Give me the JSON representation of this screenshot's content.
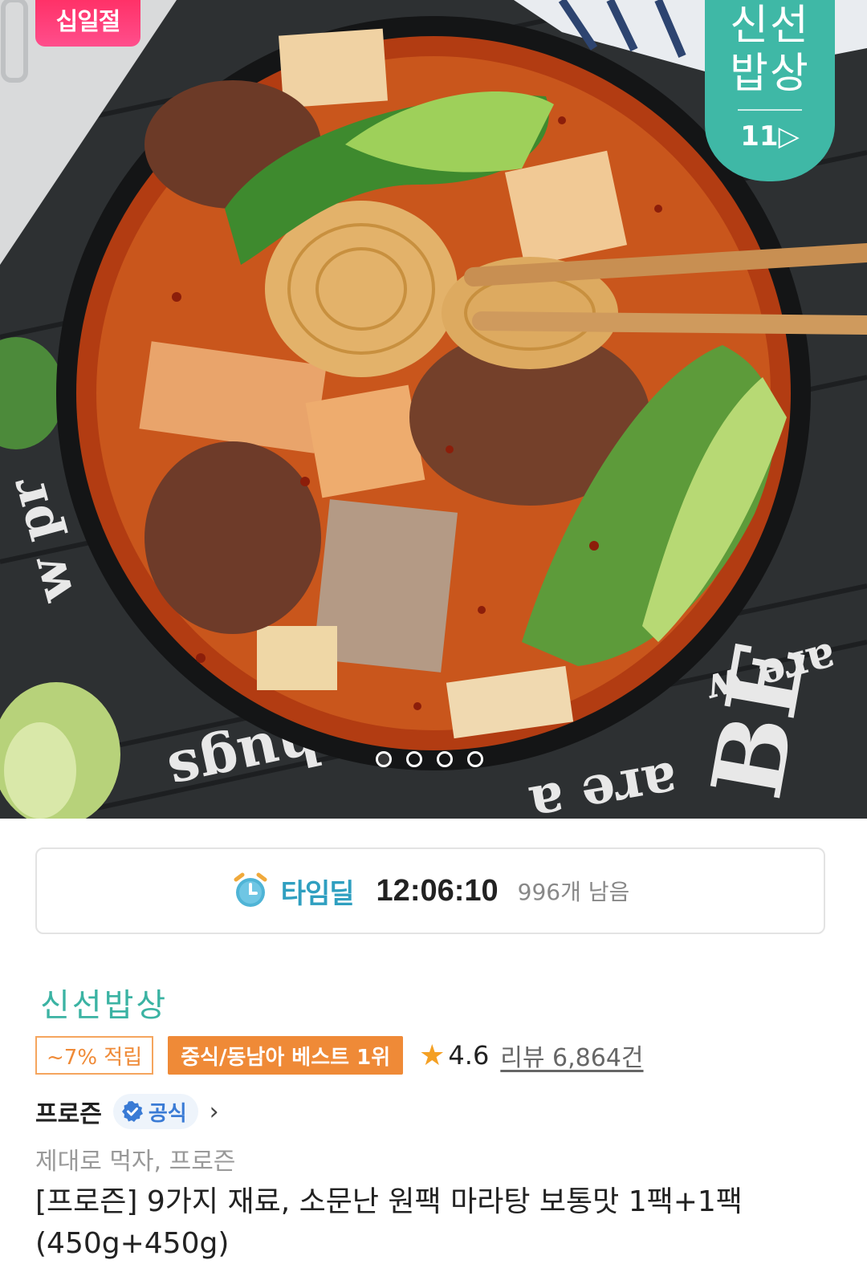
{
  "hero": {
    "event_tag": "십일절",
    "brand_badge": {
      "line1": "신선",
      "line2": "밥상",
      "number": "11▷"
    },
    "carousel": {
      "total": 4,
      "active": 0
    },
    "background_text": [
      "BE",
      "hugs",
      "are a",
      "are w",
      "w pr"
    ]
  },
  "timedeal": {
    "icon": "alarm-clock-icon",
    "label": "타임딜",
    "countdown": "12:06:10",
    "remaining": "996개 남음"
  },
  "store": {
    "name": "신선밥상"
  },
  "tags": {
    "point": "~7% 적립",
    "best": "중식/동남아 베스트 1위",
    "rating": "4.6",
    "reviews": "리뷰 6,864건"
  },
  "seller": {
    "name": "프로즌",
    "official_label": "공식",
    "chevron": "›"
  },
  "product": {
    "subtitle": "제대로 먹자, 프로즌",
    "title": "[프로즌] 9가지 재료, 소문난 원팩 마라탕 보통맛 1팩+1팩 (450g+450g)"
  },
  "colors": {
    "brand_teal": "#3fb8a6",
    "timedeal_blue": "#2f9fc0",
    "best_orange": "#ef8a37",
    "event_pink": "#ff2a5f",
    "official_blue": "#3a7bd5",
    "star": "#f4a024"
  }
}
